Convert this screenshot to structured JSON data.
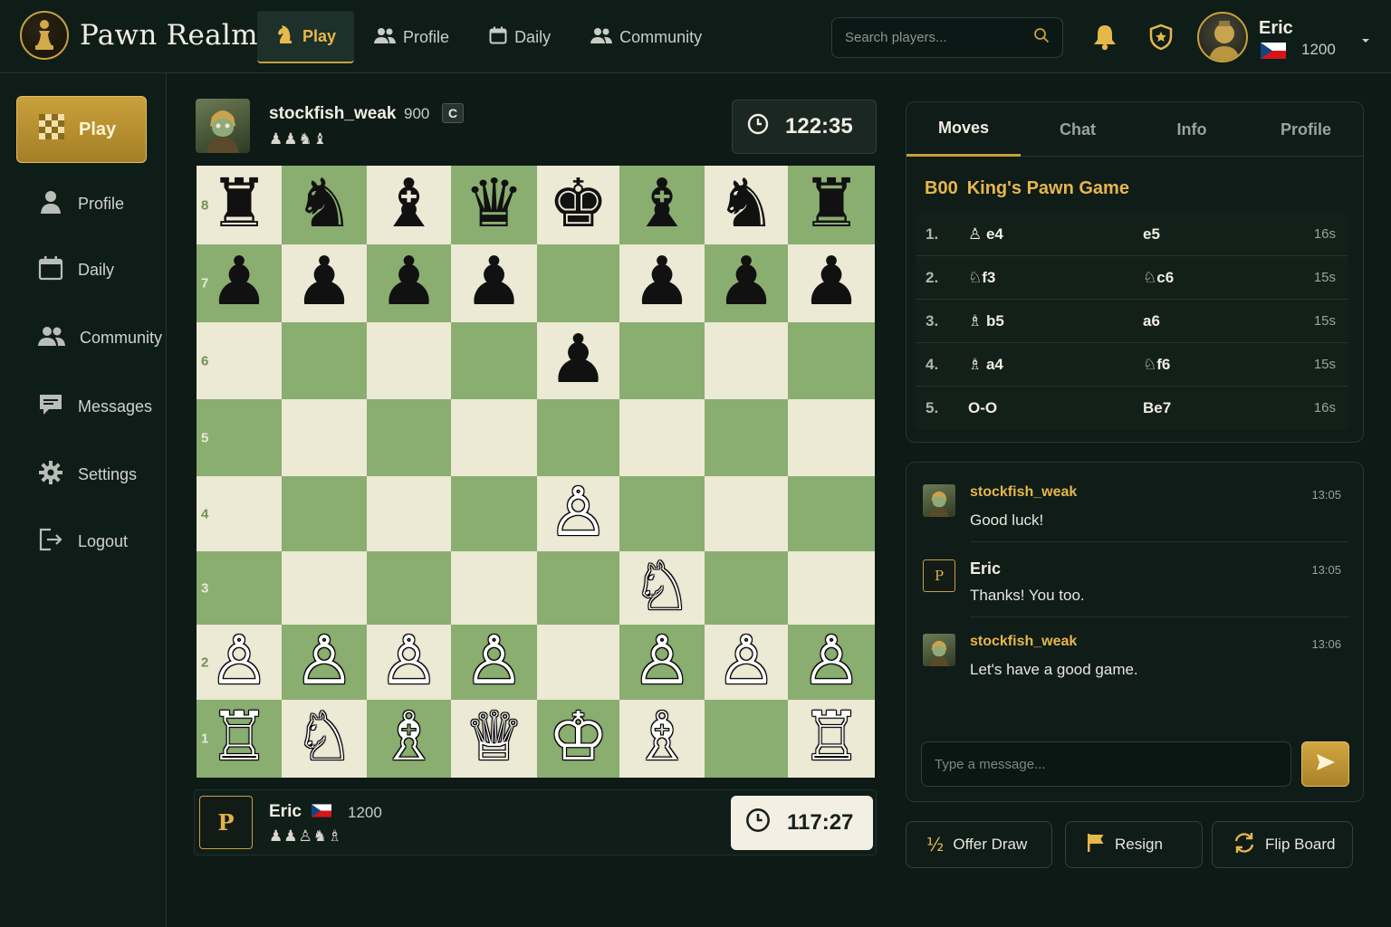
{
  "app": {
    "name": "Pawn Realm"
  },
  "nav": {
    "items": [
      {
        "label": "Play",
        "active": true
      },
      {
        "label": "Profile"
      },
      {
        "label": "Daily"
      },
      {
        "label": "Community"
      }
    ]
  },
  "search": {
    "placeholder": "Search players..."
  },
  "user": {
    "name": "Eric",
    "rating": "1200",
    "country": "Czech Republic",
    "avatar_initial": "P"
  },
  "sidebar": {
    "items": [
      {
        "label": "Play",
        "active": true
      },
      {
        "label": "Profile"
      },
      {
        "label": "Daily"
      },
      {
        "label": "Community"
      },
      {
        "label": "Messages"
      },
      {
        "label": "Settings"
      },
      {
        "label": "Logout"
      }
    ]
  },
  "opponent": {
    "name": "stockfish_weak",
    "rating": "900",
    "badge": "C",
    "captured": "♟♟♞♝",
    "clock": "122:35"
  },
  "player": {
    "name": "Eric",
    "rating": "1200",
    "captured": "♟♟♙♞♗",
    "clock": "117:27"
  },
  "board": {
    "ranks": [
      "8",
      "7",
      "6",
      "5",
      "4",
      "3",
      "2",
      "1"
    ],
    "position": [
      [
        "♜",
        "♞",
        "♝",
        "♛",
        "♚",
        "♝",
        "♞",
        "♜"
      ],
      [
        "♟",
        "♟",
        "♟",
        "♟",
        "",
        "♟",
        "♟",
        "♟"
      ],
      [
        "",
        "",
        "",
        "",
        "♟",
        "",
        "",
        ""
      ],
      [
        "",
        "",
        "",
        "",
        "",
        "",
        "",
        ""
      ],
      [
        "",
        "",
        "",
        "",
        "♙",
        "",
        "",
        ""
      ],
      [
        "",
        "",
        "",
        "",
        "",
        "♘",
        "",
        ""
      ],
      [
        "♙",
        "♙",
        "♙",
        "♙",
        "",
        "♙",
        "♙",
        "♙"
      ],
      [
        "♖",
        "♘",
        "♗",
        "♕",
        "♔",
        "♗",
        "",
        "♖"
      ]
    ]
  },
  "panel": {
    "tabs": [
      "Moves",
      "Chat",
      "Info",
      "Profile"
    ],
    "active_tab": "Moves",
    "opening": {
      "eco": "B00",
      "name": "King's Pawn Game"
    },
    "moves": [
      {
        "num": "1.",
        "white": "♙ e4",
        "black": "e5",
        "time": "16s"
      },
      {
        "num": "2.",
        "white": "♘f3",
        "black": "♘c6",
        "time": "15s"
      },
      {
        "num": "3.",
        "white": "♗ b5",
        "black": "a6",
        "time": "15s"
      },
      {
        "num": "4.",
        "white": "♗ a4",
        "black": "♘f6",
        "time": "15s"
      },
      {
        "num": "5.",
        "white": "O-O",
        "black": "Be7",
        "time": "16s"
      }
    ]
  },
  "chat": {
    "messages": [
      {
        "author": "stockfish_weak",
        "time": "13:05",
        "text": "Good luck!"
      },
      {
        "author": "Eric",
        "avatar": "P",
        "time": "13:05",
        "text": "Thanks! You too."
      },
      {
        "author": "stockfish_weak",
        "time": "13:06",
        "text": "Let's have a good game."
      }
    ],
    "placeholder": "Type a message..."
  },
  "actions": {
    "draw": {
      "icon": "½",
      "label": "Offer Draw"
    },
    "resign": "Resign",
    "flip": "Flip Board"
  },
  "colors": {
    "accent": "#c9a03c",
    "light_square": "#ece9d4",
    "dark_square": "#8aad70",
    "background": "#0d1a16"
  }
}
